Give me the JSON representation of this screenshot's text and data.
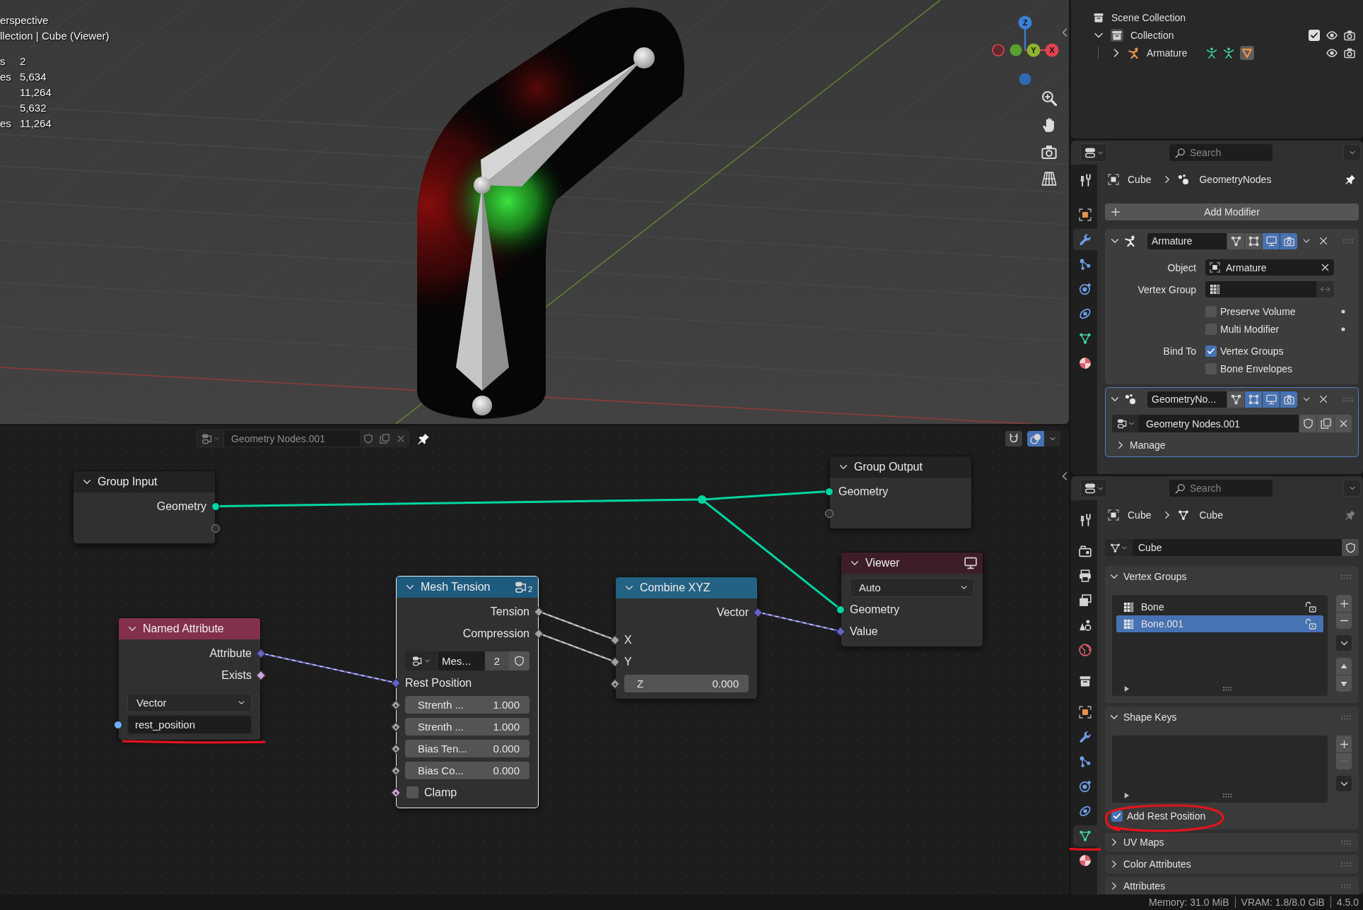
{
  "viewport": {
    "view_name": "erspective",
    "collection_line": "llection | Cube (Viewer)",
    "stats": [
      {
        "label": "s",
        "value": "2"
      },
      {
        "label": "es",
        "value": "5,634"
      },
      {
        "value": "11,264"
      },
      {
        "value": "5,632"
      },
      {
        "label": "es",
        "value": "11,264"
      }
    ],
    "gizmo_axes": [
      {
        "label": "Z"
      },
      {
        "label": "Y"
      },
      {
        "label": "X"
      }
    ]
  },
  "node_editor": {
    "header": {
      "node_group": "Geometry Nodes.001",
      "pinned": true,
      "snapping": false,
      "overlays": true
    },
    "nodes": [
      {
        "kind": "interface",
        "title": "Group Input",
        "selected": false,
        "rows": [
          {
            "kind": "output",
            "label": "Geometry",
            "socket": {
              "kind": "circle",
              "color": "#00d6a3"
            }
          },
          {
            "kind": "output",
            "socket": {
              "kind": "ring"
            }
          }
        ]
      },
      {
        "kind": "interface",
        "title": "Group Output",
        "selected": false,
        "rows": [
          {
            "kind": "input",
            "label": "Geometry",
            "socket": {
              "kind": "circle",
              "color": "#00d6a3"
            }
          },
          {
            "kind": "input",
            "socket": {
              "kind": "ring"
            }
          }
        ]
      },
      {
        "kind": "input",
        "title": "Named Attribute",
        "selected": false,
        "rows": [
          {
            "kind": "output",
            "label": "Attribute",
            "socket": {
              "kind": "diamond",
              "color": "#6363c7"
            }
          },
          {
            "kind": "output",
            "label": "Exists",
            "socket": {
              "kind": "diamond",
              "color": "#cca6d6"
            }
          },
          {
            "kind": "dropdown",
            "value": "Vector"
          },
          {
            "kind": "text",
            "value": "rest_position",
            "socket": {
              "kind": "circle",
              "color": "#70b2ff"
            }
          }
        ]
      },
      {
        "kind": "group",
        "title": "Mesh Tension",
        "badge": "2",
        "selected": true,
        "rows": [
          {
            "kind": "output",
            "label": "Tension",
            "socket": {
              "kind": "diamond",
              "color": "#a1a1a1"
            }
          },
          {
            "kind": "output",
            "label": "Compression",
            "socket": {
              "kind": "diamond",
              "color": "#a1a1a1"
            }
          },
          {
            "kind": "datablock",
            "value": "Mes...",
            "users": "2"
          },
          {
            "kind": "input",
            "label": "Rest Position",
            "socket": {
              "kind": "diamond",
              "color": "#6363c7"
            }
          },
          {
            "kind": "number",
            "label": "Strenth ...",
            "value": "1.000",
            "socket": {
              "kind": "diamond-dot",
              "color": "#a1a1a1"
            }
          },
          {
            "kind": "number",
            "label": "Strenth ...",
            "value": "1.000",
            "socket": {
              "kind": "diamond-dot",
              "color": "#a1a1a1"
            }
          },
          {
            "kind": "number",
            "label": "Bias Ten...",
            "value": "0.000",
            "socket": {
              "kind": "diamond-dot",
              "color": "#a1a1a1"
            }
          },
          {
            "kind": "number",
            "label": "Bias Co...",
            "value": "0.000",
            "socket": {
              "kind": "diamond-dot",
              "color": "#a1a1a1"
            }
          },
          {
            "kind": "checkbox",
            "label": "Clamp",
            "checked": false,
            "socket": {
              "kind": "diamond-dot",
              "color": "#cca6d6"
            }
          }
        ]
      },
      {
        "kind": "converter",
        "title": "Combine XYZ",
        "selected": false,
        "rows": [
          {
            "kind": "output",
            "label": "Vector",
            "socket": {
              "kind": "diamond",
              "color": "#6363c7"
            }
          },
          {
            "kind": "input",
            "label": "X",
            "socket": {
              "kind": "diamond",
              "color": "#a1a1a1"
            }
          },
          {
            "kind": "input",
            "label": "Y",
            "socket": {
              "kind": "diamond",
              "color": "#a1a1a1"
            }
          },
          {
            "kind": "number",
            "label": "Z",
            "value": "0.000",
            "socket": {
              "kind": "diamond-dot",
              "color": "#a1a1a1"
            }
          }
        ]
      },
      {
        "kind": "output",
        "title": "Viewer",
        "selected": false,
        "rows": [
          {
            "kind": "dropdown",
            "value": "Auto"
          },
          {
            "kind": "input",
            "label": "Geometry",
            "socket": {
              "kind": "circle",
              "color": "#00d6a3"
            }
          },
          {
            "kind": "input",
            "label": "Value",
            "socket": {
              "kind": "diamond",
              "color": "#6363c7"
            }
          }
        ]
      },
      {
        "kind": "reroute",
        "color": "#00d6a3"
      }
    ]
  },
  "outliner": {
    "tree": [
      {
        "label": "Scene Collection",
        "children": [
          {
            "label": "Collection",
            "expanded": true,
            "checked": true,
            "children": [
              {
                "label": "Armature",
                "expanded": false
              }
            ]
          }
        ]
      }
    ]
  },
  "modifier_properties": {
    "search": {
      "placeholder": "Search"
    },
    "pinned": true,
    "tabs": [
      {
        "selected": false
      },
      {
        "selected": false
      },
      {
        "selected": true
      },
      {
        "selected": false
      },
      {
        "selected": false
      },
      {
        "selected": false
      },
      {
        "selected": false
      },
      {
        "selected": false
      }
    ],
    "breadcrumb": [
      "Cube",
      "GeometryNodes"
    ],
    "add_button": "Add Modifier",
    "modifiers": [
      {
        "kind": "armature",
        "name": "Armature",
        "expanded": true,
        "active": false,
        "toggles": [
          {
            "on": false
          },
          {
            "on": false
          },
          {
            "on": true
          },
          {
            "on": true
          }
        ],
        "fields": [
          {
            "kind": "object",
            "label": "Object",
            "value": "Armature"
          },
          {
            "kind": "vertex_group",
            "label": "Vertex Group"
          },
          {
            "kind": "checkbox",
            "label": "Preserve Volume",
            "checked": false,
            "decorator": true
          },
          {
            "kind": "checkbox",
            "label": "Multi Modifier",
            "checked": false,
            "decorator": true
          },
          {
            "kind": "checkbox",
            "group_label": "Bind To",
            "label": "Vertex Groups",
            "checked": true
          },
          {
            "kind": "checkbox",
            "label": "Bone Envelopes",
            "checked": false
          }
        ]
      },
      {
        "kind": "geometry_nodes",
        "name": "GeometryNo...",
        "expanded": true,
        "active": true,
        "toggles": [
          {
            "on": false
          },
          {
            "on": true
          },
          {
            "on": true
          },
          {
            "on": true
          }
        ],
        "node_group": "Geometry Nodes.001",
        "sections": [
          {
            "label": "Manage",
            "expanded": false
          }
        ]
      }
    ]
  },
  "data_properties": {
    "search": {
      "placeholder": "Search"
    },
    "pinned": false,
    "tabs": [
      {
        "selected": false
      },
      {
        "selected": false
      },
      {
        "selected": false
      },
      {
        "selected": false
      },
      {
        "selected": false
      },
      {
        "selected": false
      },
      {
        "selected": false
      },
      {
        "selected": false
      },
      {
        "selected": false
      },
      {
        "selected": false
      },
      {
        "selected": false
      },
      {
        "selected": false
      },
      {
        "selected": true
      },
      {
        "selected": false
      }
    ],
    "breadcrumb": [
      "Cube",
      "Cube"
    ],
    "mesh": "Cube",
    "panels": [
      {
        "kind": "vertex_groups",
        "title": "Vertex Groups",
        "expanded": true,
        "remove_disabled": false,
        "items": [
          {
            "name": "Bone",
            "selected": false,
            "locked": false
          },
          {
            "name": "Bone.001",
            "selected": true,
            "locked": false
          }
        ]
      },
      {
        "kind": "shape_keys",
        "title": "Shape Keys",
        "expanded": true,
        "remove_disabled": true,
        "option": {
          "label": "Add Rest Position",
          "checked": true
        }
      },
      {
        "kind": "plain",
        "title": "UV Maps",
        "expanded": false
      },
      {
        "kind": "plain",
        "title": "Color Attributes",
        "expanded": false
      },
      {
        "kind": "plain",
        "title": "Attributes",
        "expanded": false
      }
    ]
  },
  "status_bar": [
    "Memory: 31.0 MiB",
    "VRAM: 1.8/8.0 GiB",
    "4.5.0"
  ],
  "annotations": [
    {
      "kind": "underline"
    },
    {
      "kind": "ellipse"
    },
    {
      "kind": "underline"
    }
  ]
}
